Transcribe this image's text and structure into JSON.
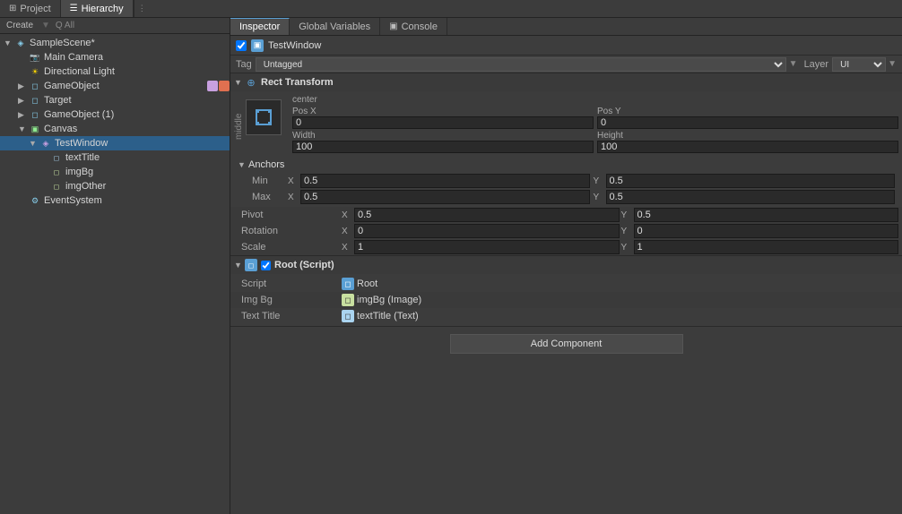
{
  "topTabs": {
    "project": "Project",
    "hierarchy": "Hierarchy",
    "activeTab": "hierarchy",
    "icons": {
      "project": "⊞",
      "hierarchy": "☰"
    }
  },
  "hierarchy": {
    "toolbar": {
      "create": "Create",
      "search": "Q All"
    },
    "items": [
      {
        "id": "samplescene",
        "label": "SampleScene*",
        "indent": 0,
        "expanded": true,
        "type": "scene"
      },
      {
        "id": "maincamera",
        "label": "Main Camera",
        "indent": 1,
        "expanded": false,
        "type": "camera"
      },
      {
        "id": "directionallight",
        "label": "Directional Light",
        "indent": 1,
        "expanded": false,
        "type": "light"
      },
      {
        "id": "gameobject",
        "label": "GameObject",
        "indent": 1,
        "expanded": false,
        "type": "gameobj"
      },
      {
        "id": "target",
        "label": "Target",
        "indent": 1,
        "expanded": false,
        "type": "gameobj"
      },
      {
        "id": "gameobject1",
        "label": "GameObject (1)",
        "indent": 1,
        "expanded": false,
        "type": "gameobj"
      },
      {
        "id": "canvas",
        "label": "Canvas",
        "indent": 1,
        "expanded": true,
        "type": "canvas"
      },
      {
        "id": "testwindow",
        "label": "TestWindow",
        "indent": 2,
        "expanded": true,
        "type": "script",
        "selected": true
      },
      {
        "id": "texttitle",
        "label": "textTitle",
        "indent": 3,
        "expanded": false,
        "type": "small"
      },
      {
        "id": "imgbg",
        "label": "imgBg",
        "indent": 3,
        "expanded": false,
        "type": "small"
      },
      {
        "id": "imgother",
        "label": "imgOther",
        "indent": 3,
        "expanded": false,
        "type": "small"
      },
      {
        "id": "eventsystem",
        "label": "EventSystem",
        "indent": 1,
        "expanded": false,
        "type": "eventsys"
      }
    ]
  },
  "inspector": {
    "tabs": [
      {
        "id": "inspector",
        "label": "Inspector",
        "active": true
      },
      {
        "id": "globalvariables",
        "label": "Global Variables",
        "active": false
      },
      {
        "id": "console",
        "label": "Console",
        "active": false
      }
    ],
    "gameObject": {
      "icon": "▣",
      "enabled": true,
      "name": "TestWindow",
      "tag": "Untagged",
      "layer": "UI"
    },
    "rectTransform": {
      "title": "Rect Transform",
      "centerLabel": "center",
      "middleLabel": "middle",
      "posX": {
        "label": "Pos X",
        "value": "0"
      },
      "posY": {
        "label": "Pos Y",
        "value": "0"
      },
      "width": {
        "label": "Width",
        "value": "100"
      },
      "height": {
        "label": "Height",
        "value": "100"
      },
      "anchors": {
        "title": "Anchors",
        "min": {
          "label": "Min",
          "x": {
            "axis": "X",
            "value": "0.5"
          },
          "y": {
            "axis": "Y",
            "value": "0.5"
          }
        },
        "max": {
          "label": "Max",
          "x": {
            "axis": "X",
            "value": "0.5"
          },
          "y": {
            "axis": "Y",
            "value": "0.5"
          }
        }
      },
      "pivot": {
        "label": "Pivot",
        "x": {
          "axis": "X",
          "value": "0.5"
        },
        "y": {
          "axis": "Y",
          "value": "0.5"
        }
      },
      "rotation": {
        "label": "Rotation",
        "x": {
          "axis": "X",
          "value": "0"
        },
        "y": {
          "axis": "Y",
          "value": "0"
        }
      },
      "scale": {
        "label": "Scale",
        "x": {
          "axis": "X",
          "value": "1"
        },
        "y": {
          "axis": "Y",
          "value": "1"
        }
      }
    },
    "rootScript": {
      "title": "Root (Script)",
      "enabled": true,
      "script": {
        "label": "Script",
        "value": "Root"
      },
      "imgBg": {
        "label": "Img Bg",
        "value": "imgBg (Image)"
      },
      "textTitle": {
        "label": "Text Title",
        "value": "textTitle (Text)"
      }
    },
    "addComponent": {
      "label": "Add Component"
    }
  }
}
